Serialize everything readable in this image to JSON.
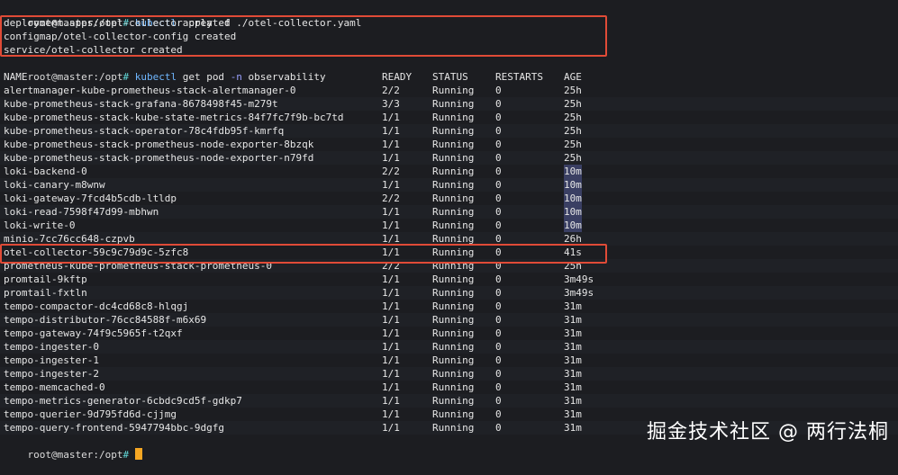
{
  "prompt1": {
    "prompt": "root@master:/opt",
    "hash": "#",
    "cmd": "kubectl",
    "args": " apply -f ./otel-collector.yaml"
  },
  "apply_output": [
    "deployment.apps/otel-collector created",
    "configmap/otel-collector-config created",
    "service/otel-collector created"
  ],
  "prompt2": {
    "prompt": "root@master:/opt",
    "hash": "#",
    "cmd": "kubectl",
    "args1": " get pod ",
    "flag": "-n",
    "args2": " observability"
  },
  "table": {
    "headers": {
      "name": "NAME",
      "ready": "READY",
      "status": "STATUS",
      "restarts": "RESTARTS",
      "age": "AGE"
    },
    "rows": [
      {
        "name": "alertmanager-kube-prometheus-stack-alertmanager-0",
        "ready": "2/2",
        "status": "Running",
        "restarts": "0",
        "age": "25h"
      },
      {
        "name": "kube-prometheus-stack-grafana-8678498f45-m279t",
        "ready": "3/3",
        "status": "Running",
        "restarts": "0",
        "age": "25h"
      },
      {
        "name": "kube-prometheus-stack-kube-state-metrics-84f7fc7f9b-bc7td",
        "ready": "1/1",
        "status": "Running",
        "restarts": "0",
        "age": "25h"
      },
      {
        "name": "kube-prometheus-stack-operator-78c4fdb95f-kmrfq",
        "ready": "1/1",
        "status": "Running",
        "restarts": "0",
        "age": "25h"
      },
      {
        "name": "kube-prometheus-stack-prometheus-node-exporter-8bzqk",
        "ready": "1/1",
        "status": "Running",
        "restarts": "0",
        "age": "25h"
      },
      {
        "name": "kube-prometheus-stack-prometheus-node-exporter-n79fd",
        "ready": "1/1",
        "status": "Running",
        "restarts": "0",
        "age": "25h"
      },
      {
        "name": "loki-backend-0",
        "ready": "2/2",
        "status": "Running",
        "restarts": "0",
        "age": "10m"
      },
      {
        "name": "loki-canary-m8wnw",
        "ready": "1/1",
        "status": "Running",
        "restarts": "0",
        "age": "10m"
      },
      {
        "name": "loki-gateway-7fcd4b5cdb-ltldp",
        "ready": "2/2",
        "status": "Running",
        "restarts": "0",
        "age": "10m"
      },
      {
        "name": "loki-read-7598f47d99-mbhwn",
        "ready": "1/1",
        "status": "Running",
        "restarts": "0",
        "age": "10m"
      },
      {
        "name": "loki-write-0",
        "ready": "1/1",
        "status": "Running",
        "restarts": "0",
        "age": "10m"
      },
      {
        "name": "minio-7cc76cc648-czpvb",
        "ready": "1/1",
        "status": "Running",
        "restarts": "0",
        "age": "26h"
      },
      {
        "name": "otel-collector-59c9c79d9c-5zfc8",
        "ready": "1/1",
        "status": "Running",
        "restarts": "0",
        "age": "41s"
      },
      {
        "name": "prometheus-kube-prometheus-stack-prometheus-0",
        "ready": "2/2",
        "status": "Running",
        "restarts": "0",
        "age": "25h"
      },
      {
        "name": "promtail-9kftp",
        "ready": "1/1",
        "status": "Running",
        "restarts": "0",
        "age": "3m49s"
      },
      {
        "name": "promtail-fxtln",
        "ready": "1/1",
        "status": "Running",
        "restarts": "0",
        "age": "3m49s"
      },
      {
        "name": "tempo-compactor-dc4cd68c8-hlqgj",
        "ready": "1/1",
        "status": "Running",
        "restarts": "0",
        "age": "31m"
      },
      {
        "name": "tempo-distributor-76cc84588f-m6x69",
        "ready": "1/1",
        "status": "Running",
        "restarts": "0",
        "age": "31m"
      },
      {
        "name": "tempo-gateway-74f9c5965f-t2qxf",
        "ready": "1/1",
        "status": "Running",
        "restarts": "0",
        "age": "31m"
      },
      {
        "name": "tempo-ingester-0",
        "ready": "1/1",
        "status": "Running",
        "restarts": "0",
        "age": "31m"
      },
      {
        "name": "tempo-ingester-1",
        "ready": "1/1",
        "status": "Running",
        "restarts": "0",
        "age": "31m"
      },
      {
        "name": "tempo-ingester-2",
        "ready": "1/1",
        "status": "Running",
        "restarts": "0",
        "age": "31m"
      },
      {
        "name": "tempo-memcached-0",
        "ready": "1/1",
        "status": "Running",
        "restarts": "0",
        "age": "31m"
      },
      {
        "name": "tempo-metrics-generator-6cbdc9cd5f-gdkp7",
        "ready": "1/1",
        "status": "Running",
        "restarts": "0",
        "age": "31m"
      },
      {
        "name": "tempo-querier-9d795fd6d-cjjmg",
        "ready": "1/1",
        "status": "Running",
        "restarts": "0",
        "age": "31m"
      },
      {
        "name": "tempo-query-frontend-5947794bbc-9dgfg",
        "ready": "1/1",
        "status": "Running",
        "restarts": "0",
        "age": "31m"
      }
    ]
  },
  "prompt3": {
    "prompt": "root@master:/opt",
    "hash": "#"
  },
  "watermark": "掘金技术社区 @ 两行法桐",
  "colors": {
    "highlight": "#e04b37",
    "cursor": "#f5a623",
    "background": "#1c1d21"
  }
}
